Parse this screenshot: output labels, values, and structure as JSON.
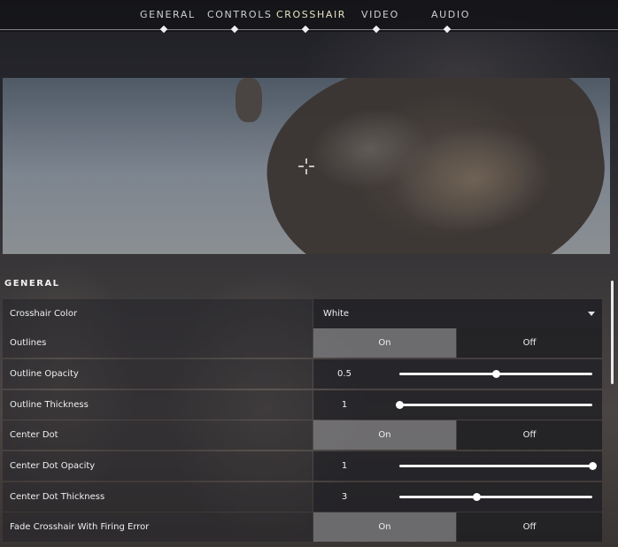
{
  "nav": {
    "tabs": [
      {
        "label": "GENERAL"
      },
      {
        "label": "CONTROLS"
      },
      {
        "label": "CROSSHAIR"
      },
      {
        "label": "VIDEO"
      },
      {
        "label": "AUDIO"
      }
    ],
    "active_tab": "CROSSHAIR"
  },
  "section": {
    "title": "GENERAL"
  },
  "settings": {
    "crosshair_color": {
      "label": "Crosshair Color",
      "value": "White"
    },
    "outlines": {
      "label": "Outlines",
      "on_label": "On",
      "off_label": "Off",
      "selected": "On"
    },
    "outline_opacity": {
      "label": "Outline Opacity",
      "value": "0.5",
      "fraction": 0.5
    },
    "outline_thickness": {
      "label": "Outline Thickness",
      "value": "1",
      "fraction": 0.0
    },
    "center_dot": {
      "label": "Center Dot",
      "on_label": "On",
      "off_label": "Off",
      "selected": "On"
    },
    "center_dot_opacity": {
      "label": "Center Dot Opacity",
      "value": "1",
      "fraction": 1.0
    },
    "center_dot_thickness": {
      "label": "Center Dot Thickness",
      "value": "3",
      "fraction": 0.4
    },
    "fade_crosshair": {
      "label": "Fade Crosshair With Firing Error",
      "on_label": "On",
      "off_label": "Off",
      "selected": "On"
    }
  },
  "colors": {
    "active_tab": "#e9e1c4",
    "toggle_selected": "#78787c",
    "toggle_unselected": "#1e1e22"
  }
}
